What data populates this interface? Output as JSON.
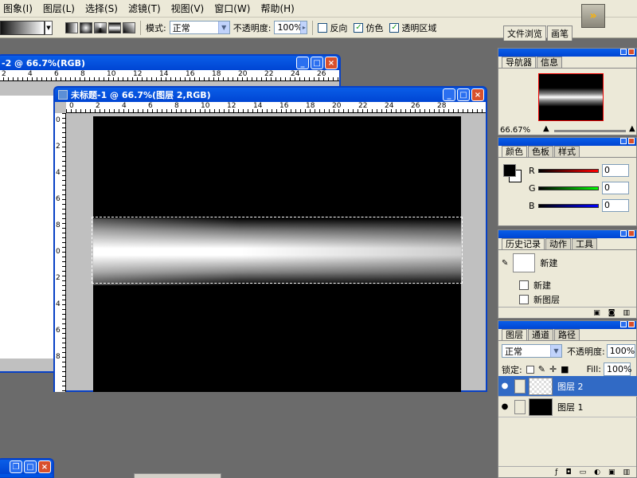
{
  "menubar": {
    "items": [
      "图象(I)",
      "图层(L)",
      "选择(S)",
      "滤镜(T)",
      "视图(V)",
      "窗口(W)",
      "帮助(H)"
    ]
  },
  "options": {
    "mode_label": "模式:",
    "mode_value": "正常",
    "opacity_label": "不透明度:",
    "opacity_value": "100%",
    "reverse_label": "反向",
    "dither_label": "仿色",
    "transparency_label": "透明区域",
    "tabs": [
      "文件浏览",
      "画笔"
    ]
  },
  "windows": {
    "back_title": "-2 @ 66.7%(RGB)",
    "main_title": "未标题-1 @ 66.7%(图层 2,RGB)",
    "ruler_h_main": [
      "0",
      "2",
      "4",
      "6",
      "8",
      "10",
      "12",
      "14",
      "16",
      "18",
      "20",
      "22",
      "24",
      "26",
      "28"
    ],
    "ruler_h_back": [
      "2",
      "4",
      "6",
      "8",
      "10",
      "12",
      "14",
      "16",
      "18",
      "20",
      "22",
      "24",
      "26"
    ],
    "ruler_v_main": [
      "0",
      "2",
      "4",
      "6",
      "8",
      "0",
      "2",
      "4",
      "6",
      "8"
    ]
  },
  "navigator": {
    "tabs": [
      "导航器",
      "信息"
    ],
    "zoom": "66.67%"
  },
  "color": {
    "tabs": [
      "颜色",
      "色板",
      "样式"
    ],
    "channels": [
      {
        "label": "R",
        "value": "0",
        "color": "#c00000"
      },
      {
        "label": "G",
        "value": "0",
        "color": "#00b000"
      },
      {
        "label": "B",
        "value": "0",
        "color": "#0000c0"
      }
    ]
  },
  "history": {
    "tabs": [
      "历史记录",
      "动作",
      "工具"
    ],
    "snapshot": "新建",
    "items": [
      "新建",
      "新图层"
    ]
  },
  "layers": {
    "tabs": [
      "图层",
      "通道",
      "路径"
    ],
    "blend": "正常",
    "opacity_label": "不透明度:",
    "opacity_value": "100%",
    "lock_label": "锁定:",
    "fill_label": "Fill:",
    "fill_value": "100%",
    "rows": [
      {
        "name": "图层 2",
        "active": true
      },
      {
        "name": "图层 1",
        "active": false
      }
    ]
  }
}
